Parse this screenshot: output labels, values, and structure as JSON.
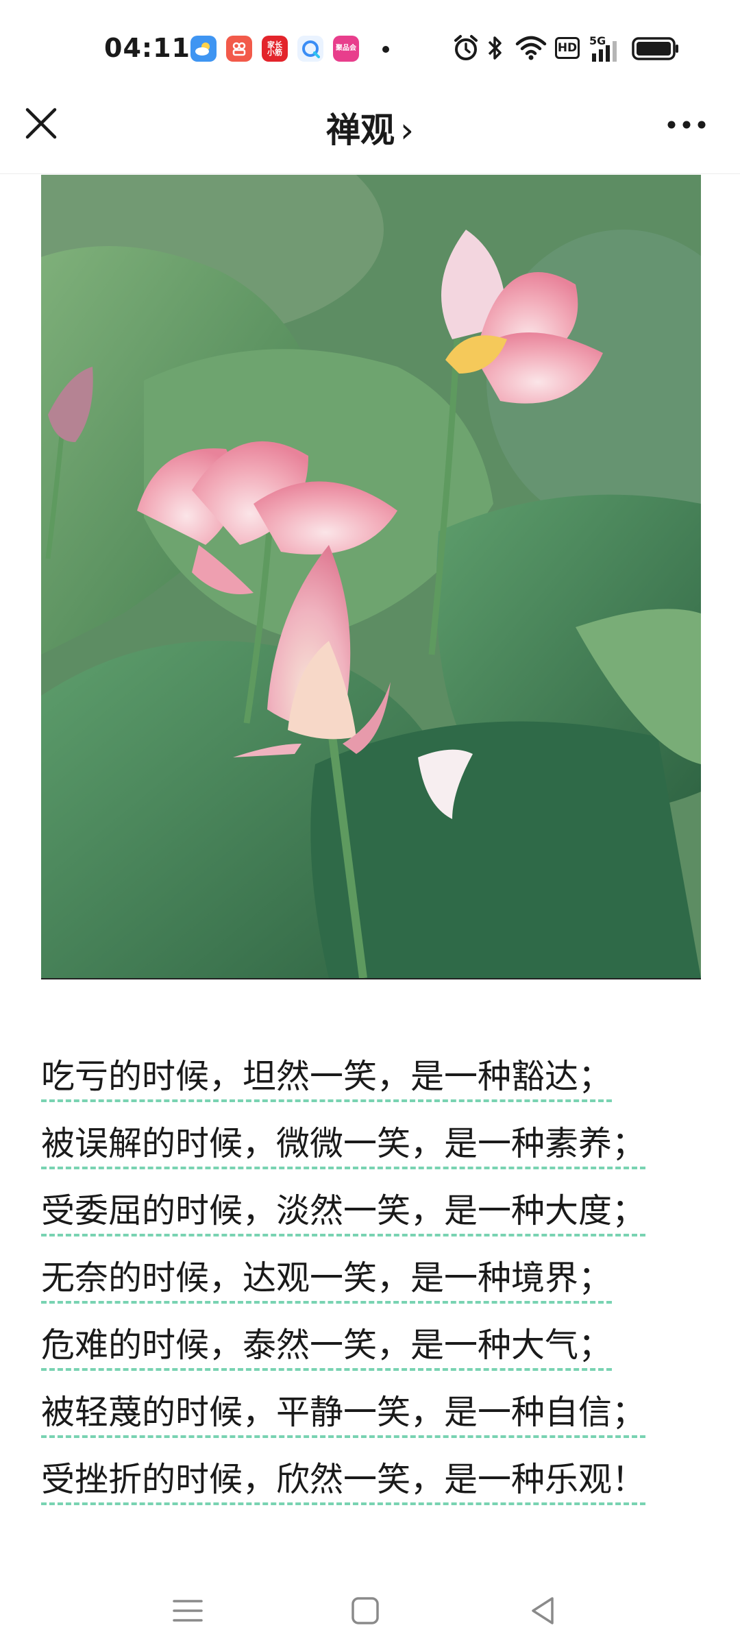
{
  "status_bar": {
    "time": "04:11",
    "app_icons": [
      {
        "name": "weather-app-icon",
        "color": "#3f95f2",
        "label": ""
      },
      {
        "name": "app-icon-2",
        "color": "#f25a4a",
        "label": ""
      },
      {
        "name": "app-icon-3",
        "color": "#e3242b",
        "label": "家长\n小筋"
      },
      {
        "name": "app-icon-4",
        "color": "#3a8df5",
        "label": ""
      },
      {
        "name": "app-icon-5",
        "color": "#e83e8c",
        "label": "聚品会"
      }
    ],
    "system_icons": [
      "alarm-icon",
      "bluetooth-icon",
      "wifi-icon",
      "hd-icon",
      "signal-5g-icon",
      "battery-icon"
    ],
    "hd_label": "HD",
    "network_label": "5G"
  },
  "title_bar": {
    "title": "禅观",
    "chevron": "›"
  },
  "photo": {
    "description_icon": "lotus-photo"
  },
  "poem": {
    "lines": [
      "吃亏的时候，坦然一笑，是一种豁达；",
      "被误解的时候，微微一笑，是一种素养；",
      "受委屈的时候，淡然一笑，是一种大度；",
      "无奈的时候，达观一笑，是一种境界；",
      "危难的时候，泰然一笑，是一种大气；",
      "被轻蔑的时候，平静一笑，是一种自信；",
      "受挫折的时候，欣然一笑，是一种乐观！"
    ]
  },
  "colors": {
    "underline": "#79d3b2",
    "text": "#1a1a1a"
  }
}
